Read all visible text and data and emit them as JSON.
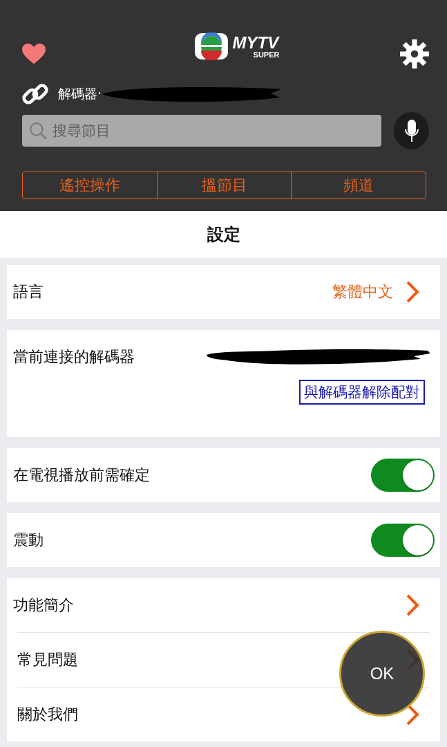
{
  "header": {
    "logo": {
      "wordmark": "MYTV",
      "sub": "SUPER"
    },
    "decoder_label": "解碼器·",
    "search": {
      "placeholder": "搜尋節目"
    },
    "segments": [
      {
        "label": "遙控操作"
      },
      {
        "label": "搵節目"
      },
      {
        "label": "頻道"
      }
    ]
  },
  "title": "設定",
  "groups": [
    {
      "items": [
        {
          "kind": "value",
          "label": "語言",
          "value": "繁體中文"
        }
      ]
    },
    {
      "items": [
        {
          "kind": "decoder",
          "label": "當前連接的解碼器",
          "action": "與解碼器解除配對"
        }
      ]
    },
    {
      "items": [
        {
          "kind": "toggle",
          "label": "在電視播放前需確定",
          "on": true
        }
      ]
    },
    {
      "items": [
        {
          "kind": "toggle",
          "label": "震動",
          "on": true
        }
      ]
    },
    {
      "items": [
        {
          "kind": "link",
          "label": "功能簡介"
        },
        {
          "kind": "link",
          "label": "常見問題"
        },
        {
          "kind": "link",
          "label": "關於我們"
        }
      ]
    }
  ],
  "fab": {
    "label": "OK"
  }
}
